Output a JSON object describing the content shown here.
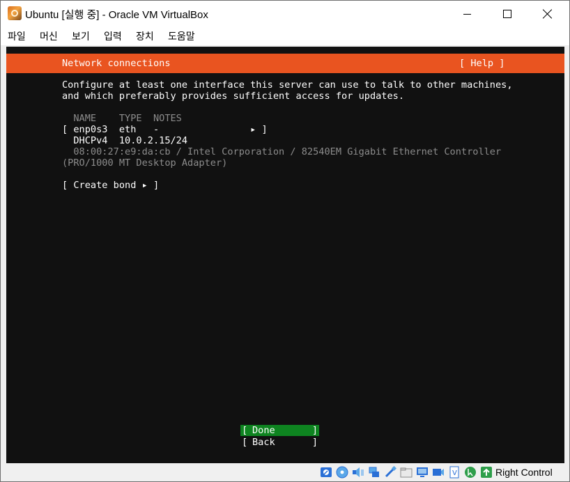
{
  "window": {
    "title": "Ubuntu [실행 중] - Oracle VM VirtualBox",
    "minimize_glyph": "",
    "maximize_glyph": "",
    "close_glyph": ""
  },
  "menubar": {
    "items": [
      {
        "label": "파일"
      },
      {
        "label": "머신"
      },
      {
        "label": "보기"
      },
      {
        "label": "입력"
      },
      {
        "label": "장치"
      },
      {
        "label": "도움말"
      }
    ]
  },
  "installer": {
    "header": {
      "title": "Network connections",
      "help": "[ Help ]"
    },
    "description": [
      "Configure at least one interface this server can use to talk to other machines,",
      "and which preferably provides sufficient access for updates."
    ],
    "table": {
      "headers": "  NAME    TYPE  NOTES",
      "interface_row": "[ enp0s3  eth   -                ▸ ]",
      "address_row": "  DHCPv4  10.0.2.15/24",
      "hw_line_1": "  08:00:27:e9:da:cb / Intel Corporation / 82540EM Gigabit Ethernet Controller",
      "hw_line_2": "(PRO/1000 MT Desktop Adapter)"
    },
    "create_bond": "[ Create bond ▸ ]",
    "buttons": {
      "done": {
        "open": "[",
        "label": "Done",
        "close": "]"
      },
      "back": {
        "open": "[",
        "label": "Back",
        "close": "]"
      }
    },
    "colors": {
      "accent": "#e95420",
      "done_bg": "#0e8420",
      "background": "#111111",
      "dim_text": "#8c8c8c"
    }
  },
  "statusbar": {
    "icons": [
      "hard-disk-icon",
      "optical-drive-icon",
      "audio-icon",
      "network-icon",
      "usb-icon",
      "shared-folder-icon",
      "display-icon",
      "recording-icon",
      "virtualization-icon",
      "mouse-integration-icon",
      "host-key-icon"
    ],
    "host_key": "Right Control"
  }
}
